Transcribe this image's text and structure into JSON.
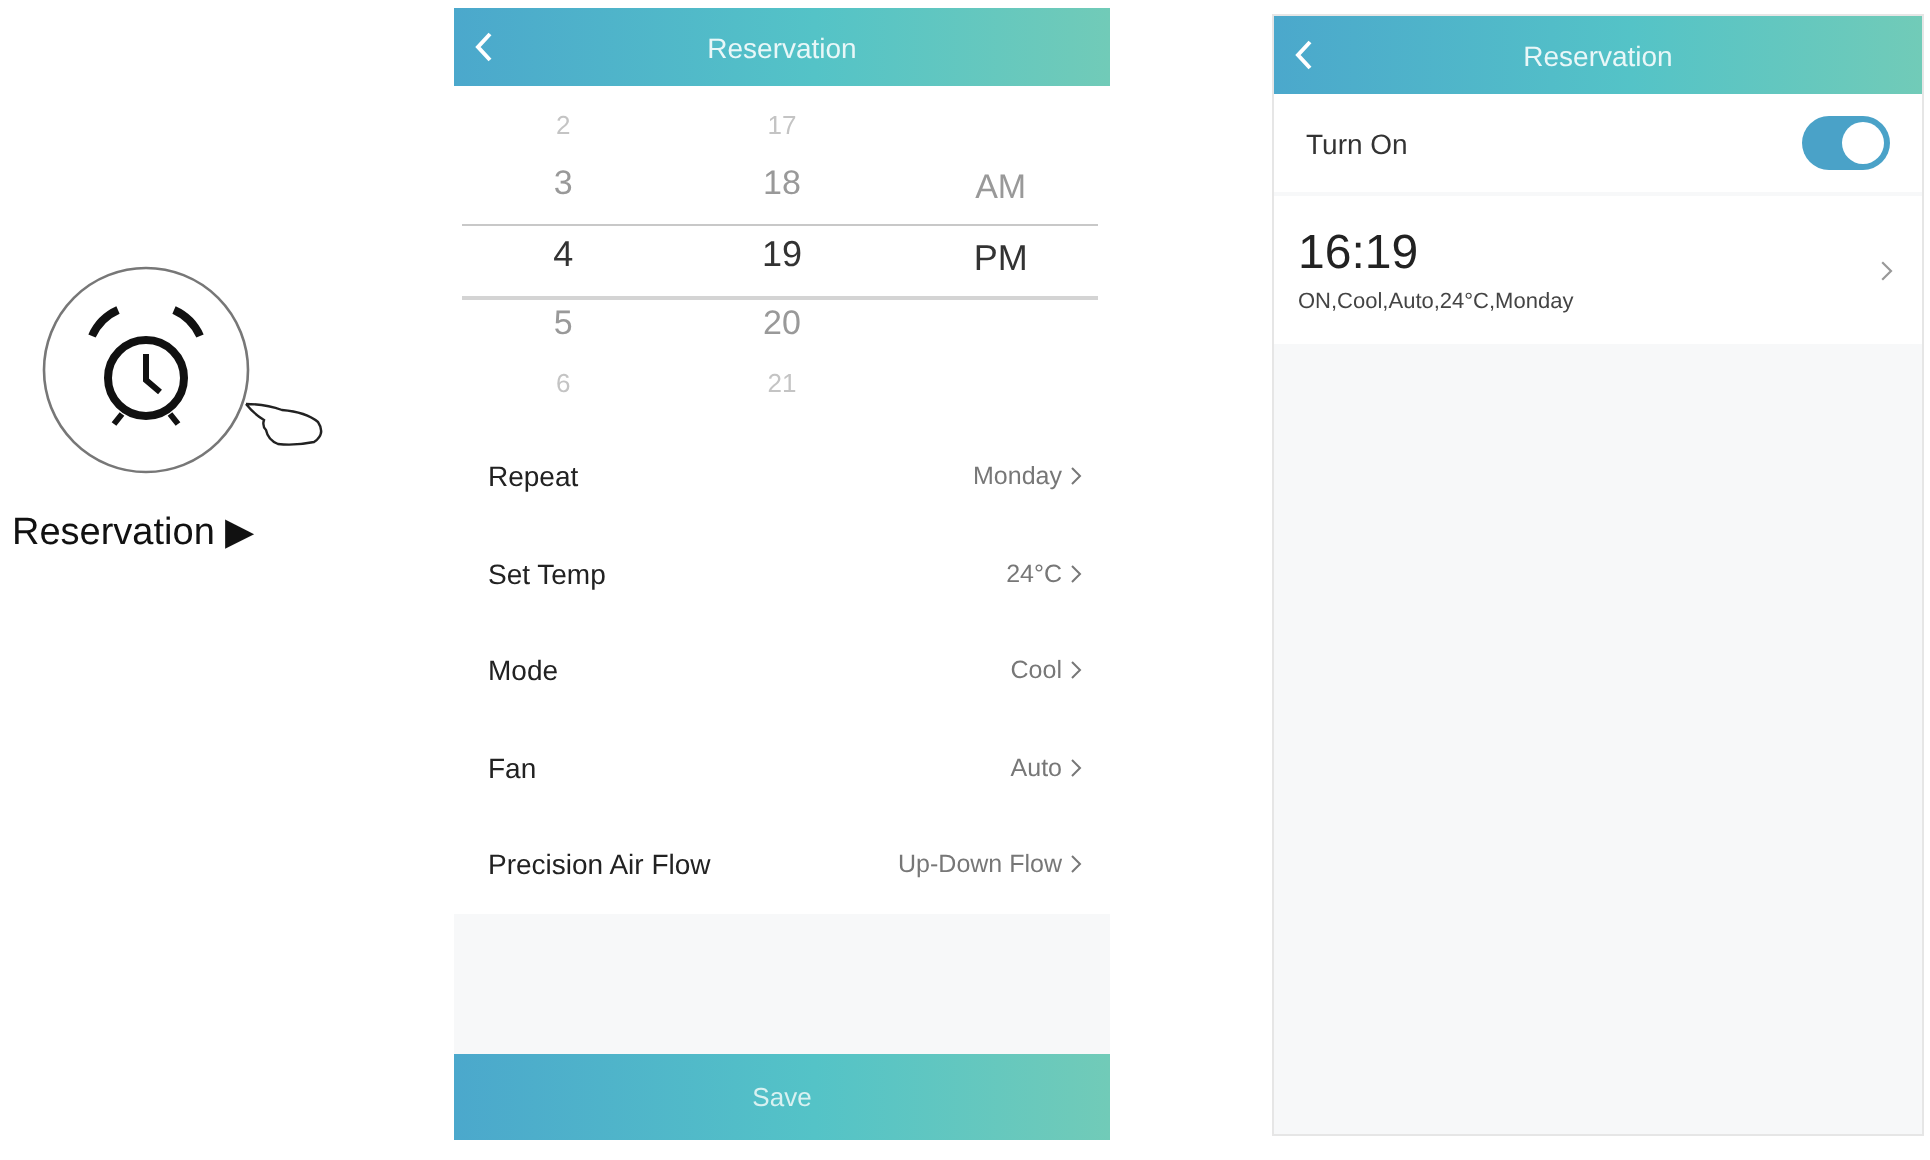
{
  "guide": {
    "label": "Reservation ▶"
  },
  "edit_screen": {
    "title": "Reservation",
    "picker": {
      "columns": [
        {
          "items": [
            {
              "text": "2",
              "selected": false
            },
            {
              "text": "3",
              "selected": false
            },
            {
              "text": "4",
              "selected": true
            },
            {
              "text": "5",
              "selected": false
            },
            {
              "text": "6",
              "selected": false
            }
          ]
        },
        {
          "items": [
            {
              "text": "17",
              "selected": false
            },
            {
              "text": "18",
              "selected": false
            },
            {
              "text": "19",
              "selected": true
            },
            {
              "text": "20",
              "selected": false
            },
            {
              "text": "21",
              "selected": false
            }
          ]
        },
        {
          "items": [
            {
              "text": "AM",
              "selected": false
            },
            {
              "text": "PM",
              "selected": true
            }
          ]
        }
      ]
    },
    "settings": [
      {
        "label": "Repeat",
        "value": "Monday"
      },
      {
        "label": "Set Temp",
        "value": "24°C"
      },
      {
        "label": "Mode",
        "value": "Cool"
      },
      {
        "label": "Fan",
        "value": "Auto"
      },
      {
        "label": "Precision Air Flow",
        "value": "Up-Down Flow"
      }
    ],
    "save_button": "Save"
  },
  "list_screen": {
    "title": "Reservation",
    "toggle": {
      "label": "Turn On",
      "on": true
    },
    "schedules": [
      {
        "time": "16:19",
        "summary": "ON,Cool,Auto,24°C,Monday"
      }
    ]
  }
}
